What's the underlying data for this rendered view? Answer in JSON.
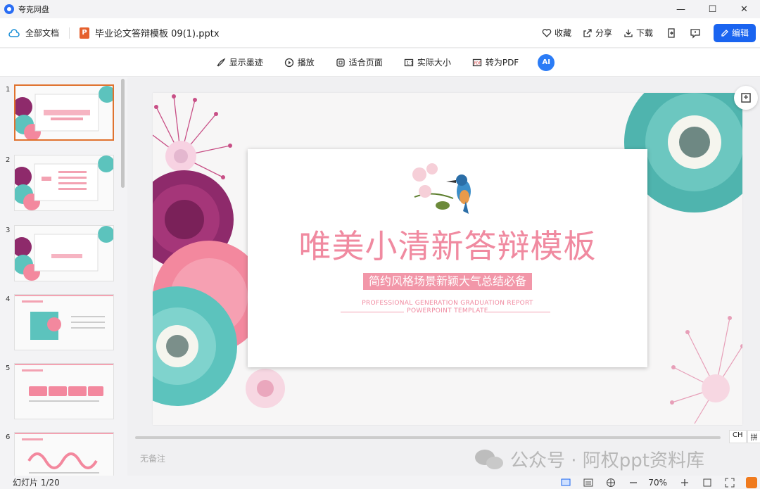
{
  "app": {
    "name": "夸克网盘"
  },
  "window": {
    "minimize": "—",
    "maximize": "☐",
    "close": "✕"
  },
  "toolbar": {
    "all_docs": "全部文档",
    "file_badge": "P",
    "filename": "毕业论文答辩模板 09(1).pptx",
    "favorite": "收藏",
    "share": "分享",
    "download": "下载",
    "edit": "编辑"
  },
  "subbar": {
    "show_ink": "显示墨迹",
    "play": "播放",
    "fit_page": "适合页面",
    "actual_size": "实际大小",
    "to_pdf": "转为PDF",
    "ai_label": "AI"
  },
  "thumbnails": [
    {
      "num": "1",
      "active": true
    },
    {
      "num": "2",
      "active": false
    },
    {
      "num": "3",
      "active": false
    },
    {
      "num": "4",
      "active": false
    },
    {
      "num": "5",
      "active": false
    },
    {
      "num": "6",
      "active": false
    }
  ],
  "slide": {
    "title": "唯美小清新答辩模板",
    "subtitle": "简约风格场景新颖大气总结必备",
    "en_line1": "PROFESSIONAL GENERATION GRADUATION REPORT",
    "en_line2": "POWERPOINT TEMPLATE"
  },
  "notes": "无备注",
  "ime": {
    "lang": "CH",
    "mode": "拼"
  },
  "watermark": "公众号 · 阿权ppt资料库",
  "status": {
    "slide_count": "幻灯片 1/20",
    "zoom": "70%"
  },
  "colors": {
    "accent": "#1a64f0",
    "active_thumb": "#e0722e",
    "slide_pink": "#f08aa0",
    "teal": "#5cc3bd",
    "magenta": "#8e2a6b"
  }
}
